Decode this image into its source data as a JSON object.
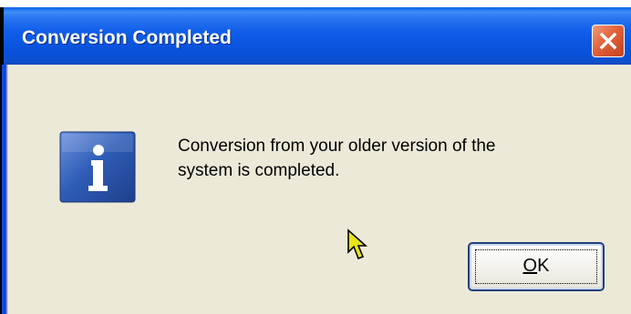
{
  "window": {
    "title": "Conversion Completed",
    "close_icon": "close-icon"
  },
  "message": {
    "icon": "info-icon",
    "line1": "Conversion from your older version of the",
    "line2": "system is completed."
  },
  "buttons": {
    "ok": {
      "mnemonic": "O",
      "rest": "K"
    }
  },
  "colors": {
    "titlebar": "#0a55e0",
    "close": "#e2623b",
    "dialog_bg": "#ece9d8",
    "info_icon": "#2f5db8"
  }
}
